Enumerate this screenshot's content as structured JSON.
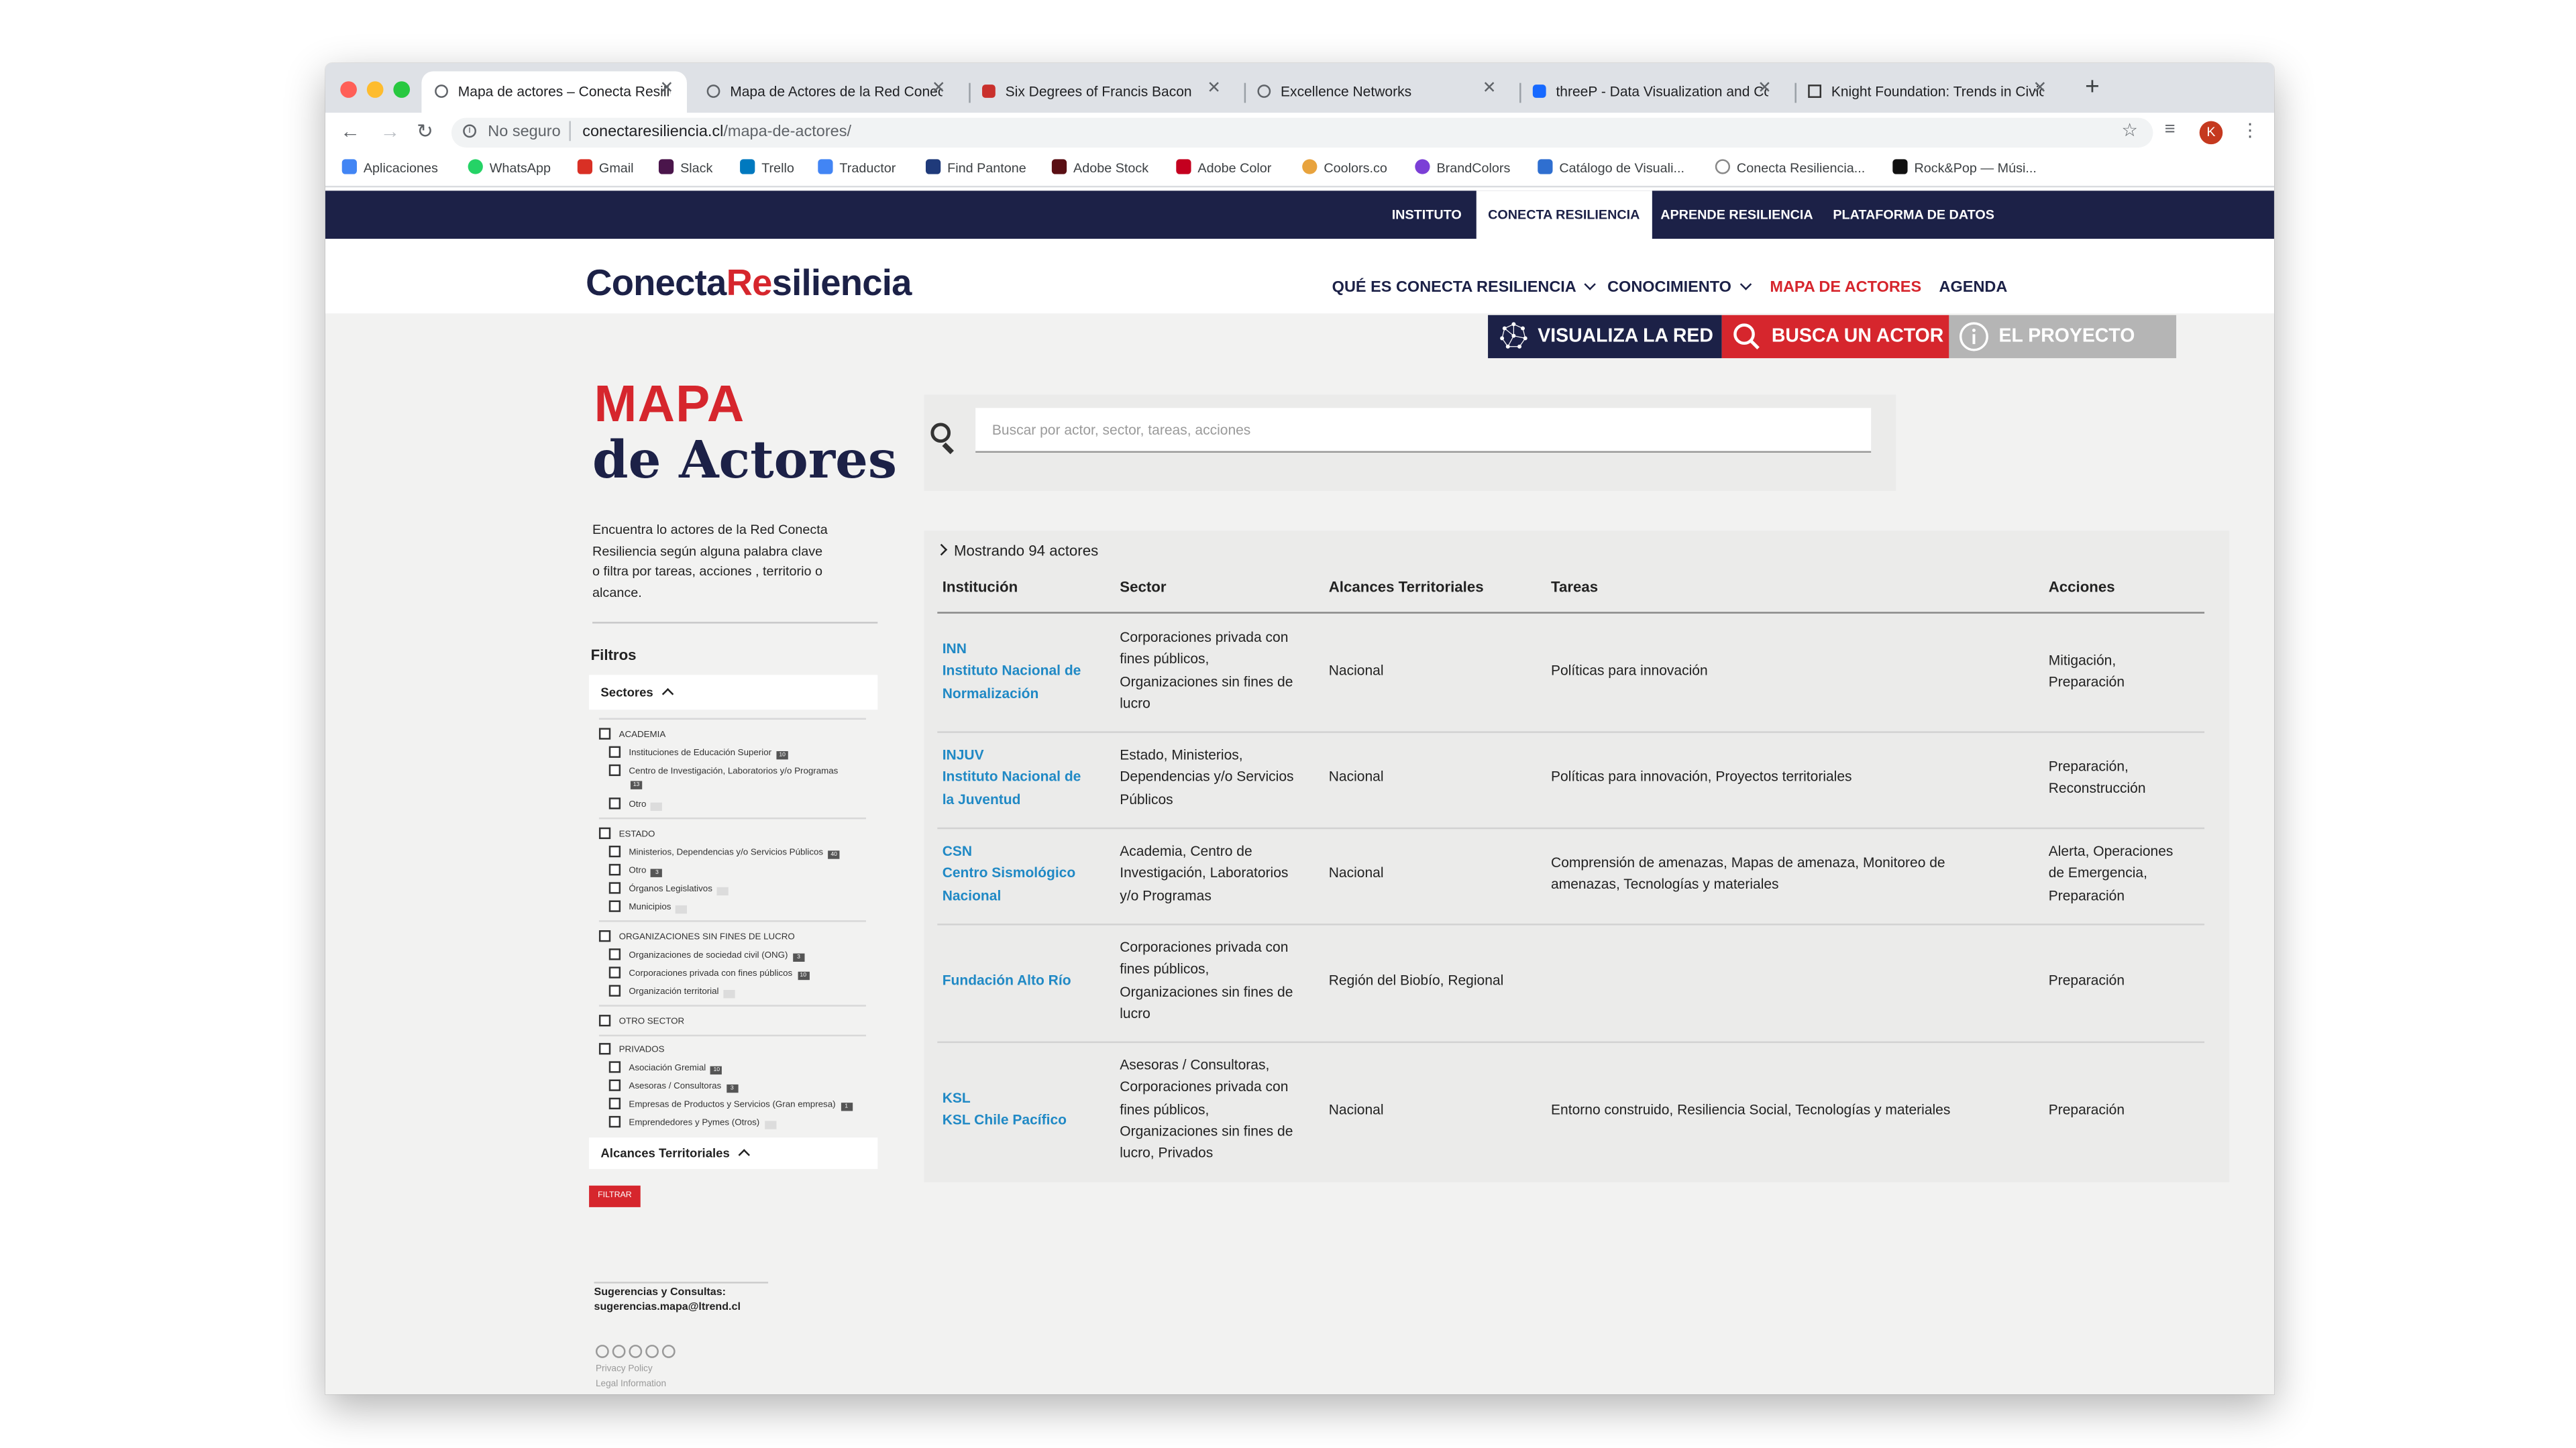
{
  "browser": {
    "tabs": [
      {
        "title": "Mapa de actores – Conecta Resiliencia",
        "icon": "globe-icon",
        "active": true
      },
      {
        "title": "Mapa de Actores de la Red Conecta Resiliencia",
        "icon": "globe-icon",
        "active": false
      },
      {
        "title": "Six Degrees of Francis Bacon",
        "icon": "bacon-icon",
        "active": false
      },
      {
        "title": "Excellence Networks",
        "icon": "globe-icon",
        "active": false
      },
      {
        "title": "threeP - Data Visualization and Content",
        "icon": "behance-icon",
        "active": false
      },
      {
        "title": "Knight Foundation: Trends in Civic Tech",
        "icon": "knight-icon",
        "active": false
      }
    ],
    "security_label": "No seguro",
    "url_host": "conectaresiliencia.cl",
    "url_path": "/mapa-de-actores/",
    "profile_initial": "K",
    "bookmarks": [
      {
        "label": "Aplicaciones",
        "color": "#4285f4"
      },
      {
        "label": "WhatsApp",
        "color": "#25d366"
      },
      {
        "label": "Gmail",
        "color": "#d93025"
      },
      {
        "label": "Slack",
        "color": "#4a154b"
      },
      {
        "label": "Trello",
        "color": "#0079bf"
      },
      {
        "label": "Traductor",
        "color": "#4285f4"
      },
      {
        "label": "Find Pantone",
        "color": "#1f3a7a"
      },
      {
        "label": "Adobe Stock",
        "color": "#5a0f14"
      },
      {
        "label": "Adobe Color",
        "color": "#c4001f"
      },
      {
        "label": "Coolors.co",
        "color": "#e8a33d"
      },
      {
        "label": "BrandColors",
        "color": "#7b3fd6"
      },
      {
        "label": "Catálogo de Visuali...",
        "color": "#2f6fd0"
      },
      {
        "label": "Conecta Resiliencia...",
        "color": "#888888"
      },
      {
        "label": "Rock&Pop — Músi...",
        "color": "#111111"
      }
    ]
  },
  "site": {
    "colors": {
      "navy": "#1c2147",
      "red": "#d6262d",
      "link": "#2089c5",
      "gray_btn": "#b5b5b5"
    },
    "topbar": [
      "INSTITUTO",
      "CONECTA RESILIENCIA",
      "APRENDE RESILIENCIA",
      "PLATAFORMA DE DATOS"
    ],
    "logo": {
      "part1": "Conecta",
      "part2": "Re",
      "part3": "siliencia"
    },
    "nav": [
      {
        "label": "QUÉ ES CONECTA RESILIENCIA",
        "dropdown": true
      },
      {
        "label": "CONOCIMIENTO",
        "dropdown": true
      },
      {
        "label": "MAPA DE ACTORES",
        "active": true
      },
      {
        "label": "AGENDA"
      }
    ],
    "action_buttons": [
      {
        "label": "VISUALIZA LA RED",
        "icon": "network-icon"
      },
      {
        "label": "BUSCA UN ACTOR",
        "icon": "search-icon"
      },
      {
        "label": "EL PROYECTO",
        "icon": "info-icon"
      }
    ]
  },
  "sidebar": {
    "title_line1": "MAPA",
    "title_line2": "de Actores",
    "intro": "Encuentra lo actores de la Red Conecta Resiliencia según alguna palabra clave o filtra por tareas, acciones , territorio o alcance.",
    "filters_label": "Filtros",
    "sectores_label": "Sectores",
    "alcances_label": "Alcances Territoriales",
    "groups": [
      {
        "label": "ACADEMIA",
        "items": [
          {
            "label": "Instituciones de Educación Superior",
            "count": "10"
          },
          {
            "label": "Centro de Investigación, Laboratorios y/o Programas",
            "count": "13"
          },
          {
            "label": "Otro",
            "count": "0"
          }
        ]
      },
      {
        "label": "ESTADO",
        "items": [
          {
            "label": "Ministerios, Dependencias y/o Servicios Públicos",
            "count": "40"
          },
          {
            "label": "Otro",
            "count": "3"
          },
          {
            "label": "Órganos Legislativos",
            "count": "0"
          },
          {
            "label": "Municipios",
            "count": "0"
          }
        ]
      },
      {
        "label": "ORGANIZACIONES SIN FINES DE LUCRO",
        "items": [
          {
            "label": "Organizaciones de sociedad civil (ONG)",
            "count": "3"
          },
          {
            "label": "Corporaciones privada con fines públicos",
            "count": "10"
          },
          {
            "label": "Organización territorial",
            "count": "0"
          }
        ]
      },
      {
        "label": "OTRO SECTOR",
        "items": []
      },
      {
        "label": "PRIVADOS",
        "items": [
          {
            "label": "Asociación Gremial",
            "count": "10"
          },
          {
            "label": "Asesoras / Consultoras",
            "count": "3"
          },
          {
            "label": "Empresas de Productos y Servicios (Gran empresa)",
            "count": "1"
          },
          {
            "label": "Emprendedores y Pymes (Otros)",
            "count": "0"
          }
        ]
      }
    ],
    "filter_button": "FILTRAR",
    "contact_line1": "Sugerencias y Consultas:",
    "contact_line2": "sugerencias.mapa@ltrend.cl",
    "license_icons": [
      "cc-icon",
      "by-icon",
      "nc-icon",
      "sa-icon",
      "nd-icon"
    ],
    "privacy": "Privacy Policy",
    "legal": "Legal Information"
  },
  "search": {
    "placeholder": "Buscar por actor, sector, tareas, acciones"
  },
  "results": {
    "showing": "Mostrando 94 actores",
    "columns": [
      "Institución",
      "Sector",
      "Alcances Territoriales",
      "Tareas",
      "Acciones"
    ],
    "rows": [
      {
        "inst": [
          "INN",
          "Instituto Nacional de",
          "Normalización"
        ],
        "sector": [
          "Corporaciones privada con",
          "fines públicos,",
          "Organizaciones sin fines de",
          "lucro"
        ],
        "alcance": [
          "Nacional"
        ],
        "tareas": [
          "Políticas para innovación"
        ],
        "acciones": [
          "Mitigación,",
          "Preparación"
        ]
      },
      {
        "inst": [
          "INJUV",
          "Instituto Nacional de",
          "la Juventud"
        ],
        "sector": [
          "Estado, Ministerios,",
          "Dependencias y/o Servicios",
          "Públicos"
        ],
        "alcance": [
          "Nacional"
        ],
        "tareas": [
          "Políticas para innovación, Proyectos territoriales"
        ],
        "acciones": [
          "Preparación,",
          "Reconstrucción"
        ]
      },
      {
        "inst": [
          "CSN",
          "Centro Sismológico",
          "Nacional"
        ],
        "sector": [
          "Academia, Centro de",
          "Investigación, Laboratorios",
          "y/o Programas"
        ],
        "alcance": [
          "Nacional"
        ],
        "tareas": [
          "Comprensión de amenazas, Mapas de amenaza, Monitoreo de",
          "amenazas, Tecnologías y materiales"
        ],
        "acciones": [
          "Alerta, Operaciones",
          "de Emergencia,",
          "Preparación"
        ]
      },
      {
        "inst": [
          "Fundación Alto Río"
        ],
        "sector": [
          "Corporaciones privada con",
          "fines públicos,",
          "Organizaciones sin fines de",
          "lucro"
        ],
        "alcance": [
          "Región del Biobío, Regional"
        ],
        "tareas": [],
        "acciones": [
          "Preparación"
        ]
      },
      {
        "inst": [
          "KSL",
          "KSL Chile Pacífico"
        ],
        "sector": [
          "Asesoras / Consultoras,",
          "Corporaciones privada con",
          "fines públicos,",
          "Organizaciones sin fines de",
          "lucro, Privados"
        ],
        "alcance": [
          "Nacional"
        ],
        "tareas": [
          "Entorno construido, Resiliencia Social, Tecnologías y materiales"
        ],
        "acciones": [
          "Preparación"
        ]
      }
    ]
  }
}
